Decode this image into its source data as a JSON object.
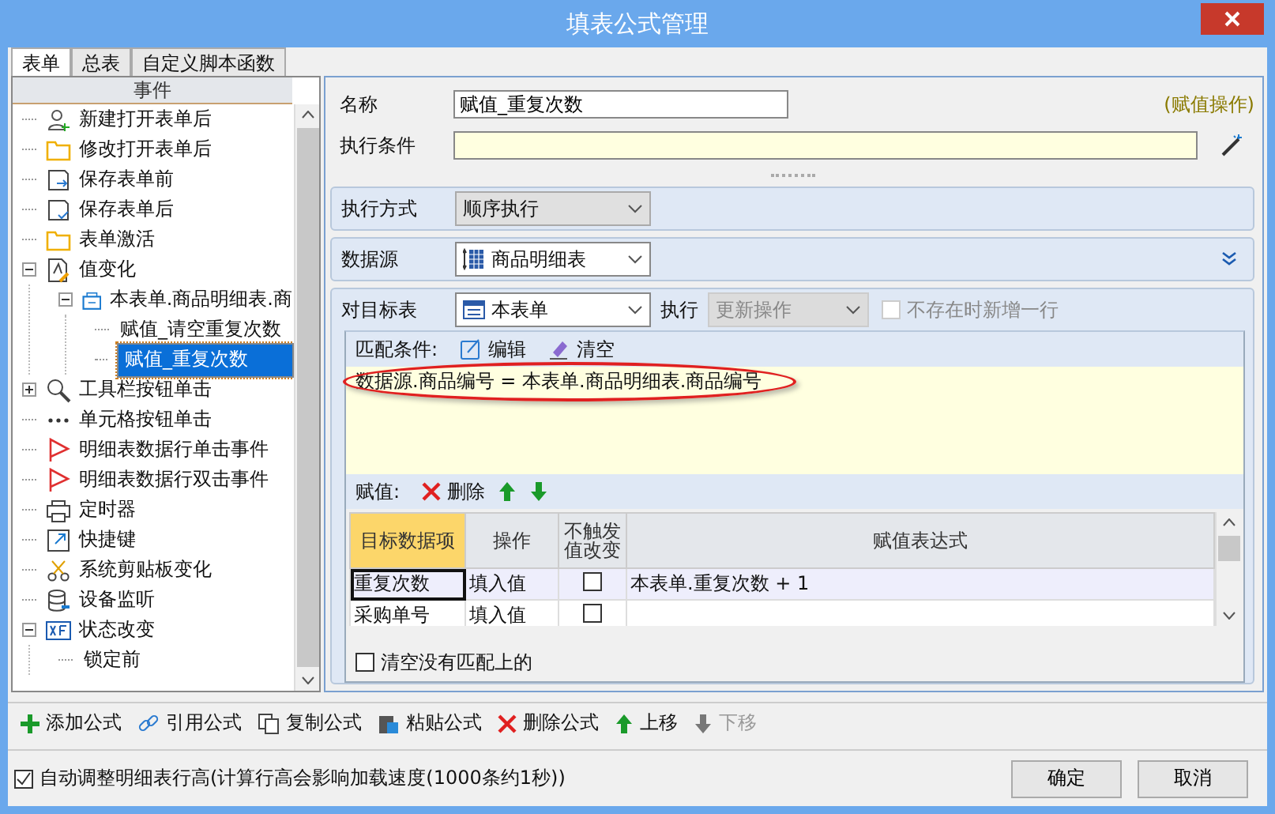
{
  "window": {
    "title": "填表公式管理"
  },
  "tabs": [
    {
      "label": "表单",
      "selected": true
    },
    {
      "label": "总表",
      "selected": false
    },
    {
      "label": "自定义脚本函数",
      "selected": false
    }
  ],
  "tree": {
    "header": "事件",
    "items": [
      {
        "label": "新建打开表单后",
        "kind": "user-add",
        "selected": false
      },
      {
        "label": "修改打开表单后",
        "kind": "folder",
        "selected": false
      },
      {
        "label": "保存表单前",
        "kind": "save-in",
        "selected": false
      },
      {
        "label": "保存表单后",
        "kind": "save-check",
        "selected": false
      },
      {
        "label": "表单激活",
        "kind": "folder",
        "selected": false
      },
      {
        "label": "值变化",
        "kind": "edit-doc",
        "selected": false,
        "expanded": true,
        "children": [
          {
            "label": "本表单.商品明细表.商",
            "kind": "table",
            "selected": false,
            "expanded": true,
            "children": [
              {
                "label": "赋值_请空重复次数",
                "selected": false
              },
              {
                "label": "赋值_重复次数",
                "selected": true
              }
            ]
          }
        ]
      },
      {
        "label": "工具栏按钮单击",
        "kind": "search-tool",
        "selected": false,
        "expanded": false
      },
      {
        "label": "单元格按钮单击",
        "kind": "dots",
        "selected": false
      },
      {
        "label": "明细表数据行单击事件",
        "kind": "flag",
        "selected": false
      },
      {
        "label": "明细表数据行双击事件",
        "kind": "flag",
        "selected": false
      },
      {
        "label": "定时器",
        "kind": "printer",
        "selected": false
      },
      {
        "label": "快捷键",
        "kind": "shortcut",
        "selected": false
      },
      {
        "label": "系统剪贴板变化",
        "kind": "scissors",
        "selected": false
      },
      {
        "label": "设备监听",
        "kind": "database",
        "selected": false
      },
      {
        "label": "状态改变",
        "kind": "xf",
        "selected": false,
        "expanded": true,
        "children": [
          {
            "label": "锁定前",
            "selected": false
          }
        ]
      }
    ]
  },
  "form": {
    "name_label": "名称",
    "name_value": "赋值_重复次数",
    "type_note": "(赋值操作)",
    "condition_label": "执行条件",
    "mode_label": "执行方式",
    "mode_value": "顺序执行",
    "source_label": "数据源",
    "source_value": "商品明细表",
    "target_label": "对目标表",
    "target_value": "本表单",
    "exec_label": "执行",
    "exec_value": "更新操作",
    "exec_disabled": true,
    "add_row": {
      "label": "不存在时新增一行",
      "checked": false,
      "disabled": true
    }
  },
  "match": {
    "label": "匹配条件:",
    "edit": "编辑",
    "clear": "清空",
    "expression": "数据源.商品编号 = 本表单.商品明细表.商品编号"
  },
  "assign": {
    "label": "赋值:",
    "delete": "删除",
    "columns": [
      "目标数据项",
      "操作",
      "不触发值改变",
      "赋值表达式"
    ],
    "rows": [
      {
        "target": "重复次数",
        "operation": "填入值",
        "no_trigger": false,
        "expression": "本表单.重复次数  + 1",
        "selected": true
      },
      {
        "target": "采购单号",
        "operation": "填入值",
        "no_trigger": false,
        "expression": "",
        "selected": false
      }
    ],
    "clear_unmatched": {
      "label": "清空没有匹配上的",
      "checked": false
    }
  },
  "toolbar": [
    {
      "label": "添加公式",
      "kind": "add",
      "disabled": false
    },
    {
      "label": "引用公式",
      "kind": "link",
      "disabled": false
    },
    {
      "label": "复制公式",
      "kind": "copy",
      "disabled": false
    },
    {
      "label": "粘贴公式",
      "kind": "paste",
      "disabled": false
    },
    {
      "label": "删除公式",
      "kind": "delete",
      "disabled": false
    },
    {
      "label": "上移",
      "kind": "up",
      "disabled": false
    },
    {
      "label": "下移",
      "kind": "down",
      "disabled": true
    }
  ],
  "footer": {
    "auto_height": {
      "label": "自动调整明细表行高(计算行高会影响加载速度(1000条约1秒))",
      "checked": true
    },
    "buttons": [
      "确定",
      "取消"
    ]
  }
}
